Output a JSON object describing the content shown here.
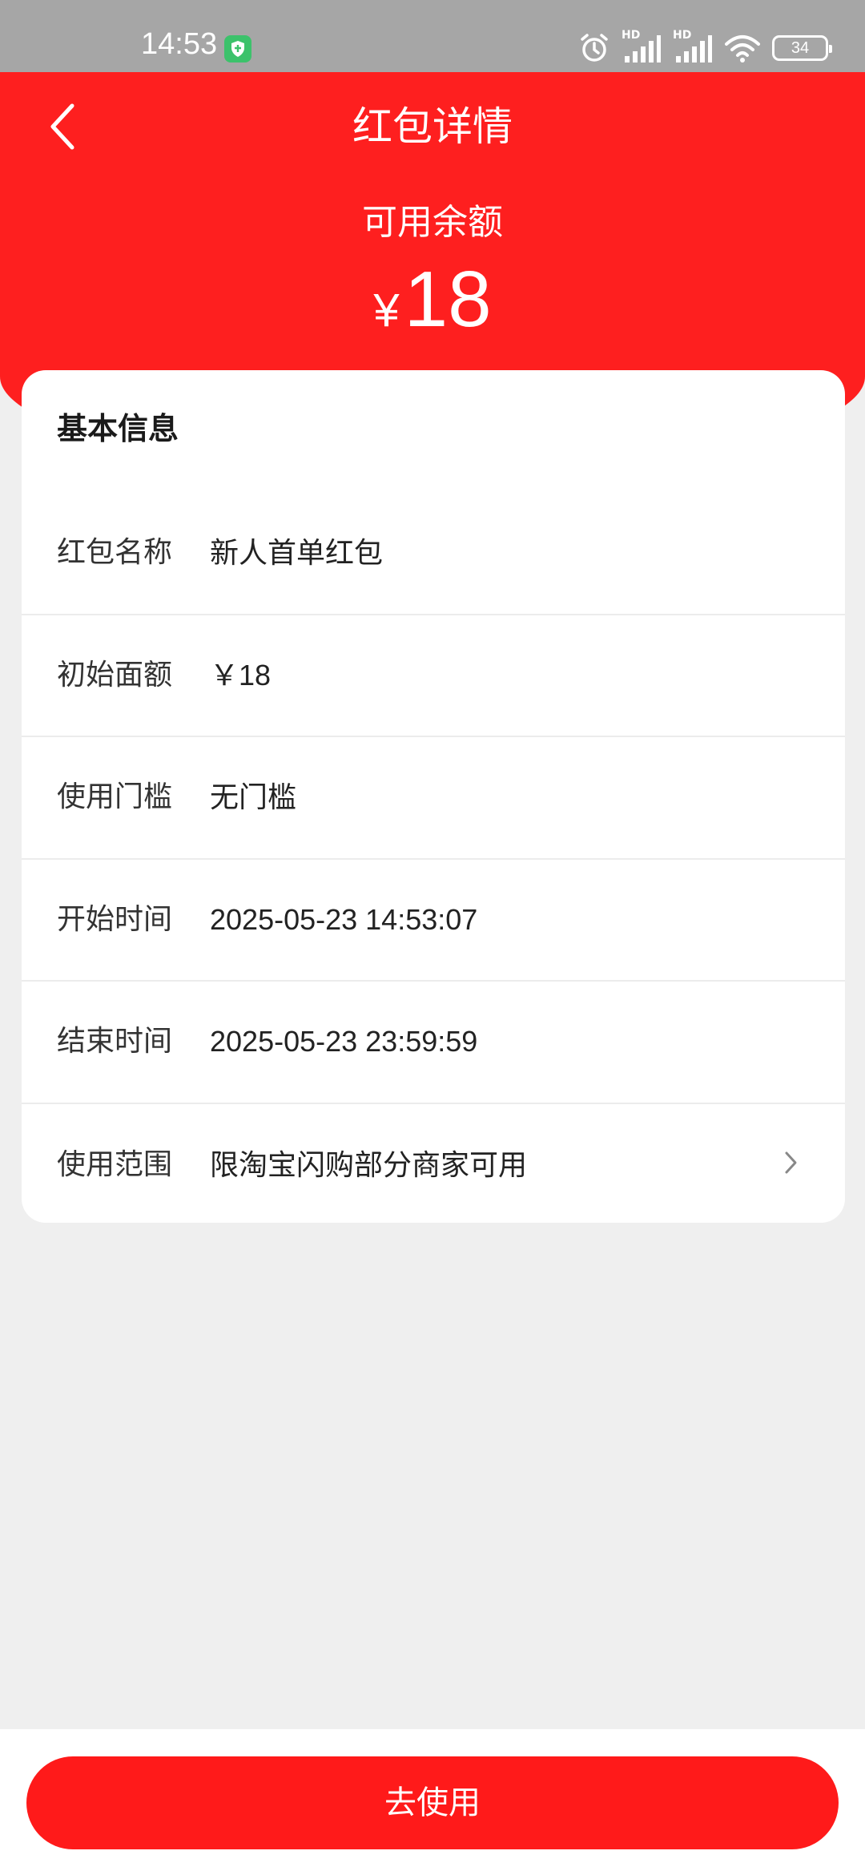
{
  "status_bar": {
    "time": "14:53",
    "battery": "34",
    "network_labels": [
      "HD",
      "HD"
    ]
  },
  "header": {
    "title": "红包详情",
    "balance_label": "可用余额",
    "currency": "¥",
    "balance": "18"
  },
  "card": {
    "title": "基本信息",
    "rows": [
      {
        "label": "红包名称",
        "value": "新人首单红包"
      },
      {
        "label": "初始面额",
        "value": "￥18"
      },
      {
        "label": "使用门槛",
        "value": "无门槛"
      },
      {
        "label": "开始时间",
        "value": "2025-05-23 14:53:07"
      },
      {
        "label": "结束时间",
        "value": "2025-05-23 23:59:59"
      },
      {
        "label": "使用范围",
        "value": "限淘宝闪购部分商家可用"
      }
    ]
  },
  "footer": {
    "use_button_label": "去使用"
  },
  "colors": {
    "header_red": "#fe1f1f",
    "button_red": "#ff1a1a",
    "background": "#efefef"
  }
}
